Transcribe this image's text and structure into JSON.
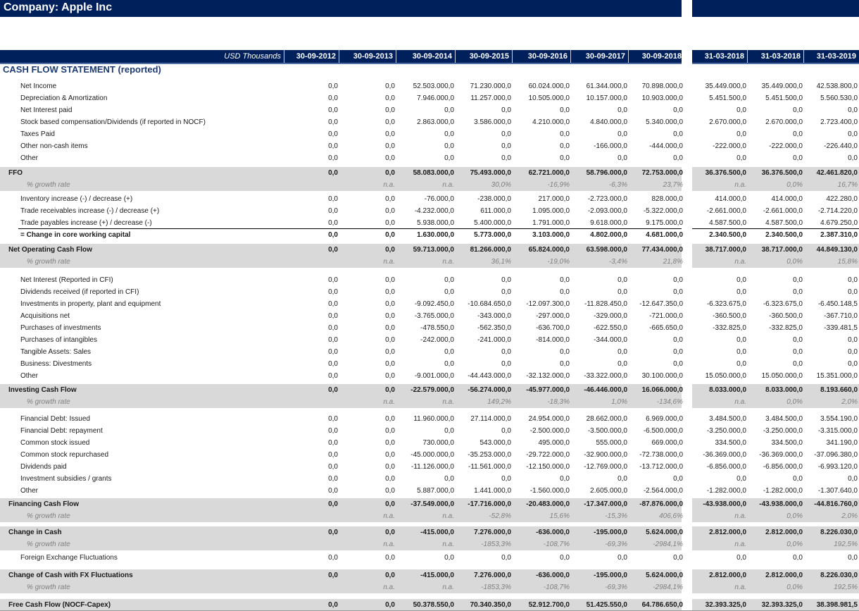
{
  "header": {
    "company_title": "Company: Apple Inc",
    "units": "USD Thousands",
    "columns": [
      "30-09-2012",
      "30-09-2013",
      "30-09-2014",
      "30-09-2015",
      "30-09-2016",
      "30-09-2017",
      "30-09-2018"
    ],
    "forecast_columns": [
      "31-03-2018",
      "31-03-2018",
      "31-03-2019"
    ]
  },
  "section_title": "CASH FLOW STATEMENT (reported)",
  "colors": {
    "header_navy": "#00205b",
    "band_gray": "#d9d9d9",
    "growth_gray": "#808080"
  },
  "rows": [
    {
      "label": "Net Income",
      "type": "item",
      "values": [
        "0,0",
        "0,0",
        "52.503.000,0",
        "71.230.000,0",
        "60.024.000,0",
        "61.344.000,0",
        "70.898.000,0"
      ],
      "forecast": [
        "35.449.000,0",
        "35.449.000,0",
        "42.538.800,0"
      ]
    },
    {
      "label": "Depreciation & Amortization",
      "type": "item",
      "values": [
        "0,0",
        "0,0",
        "7.946.000,0",
        "11.257.000,0",
        "10.505.000,0",
        "10.157.000,0",
        "10.903.000,0"
      ],
      "forecast": [
        "5.451.500,0",
        "5.451.500,0",
        "5.560.530,0"
      ]
    },
    {
      "label": "Net Interest paid",
      "type": "item",
      "values": [
        "0,0",
        "0,0",
        "0,0",
        "0,0",
        "0,0",
        "0,0",
        "0,0"
      ],
      "forecast": [
        "0,0",
        "0,0",
        "0,0"
      ]
    },
    {
      "label": "Stock based compensation/Dividends (if reported in NOCF)",
      "type": "item",
      "values": [
        "0,0",
        "0,0",
        "2.863.000,0",
        "3.586.000,0",
        "4.210.000,0",
        "4.840.000,0",
        "5.340.000,0"
      ],
      "forecast": [
        "2.670.000,0",
        "2.670.000,0",
        "2.723.400,0"
      ]
    },
    {
      "label": "Taxes Paid",
      "type": "item",
      "values": [
        "0,0",
        "0,0",
        "0,0",
        "0,0",
        "0,0",
        "0,0",
        "0,0"
      ],
      "forecast": [
        "0,0",
        "0,0",
        "0,0"
      ]
    },
    {
      "label": "Other non-cash items",
      "type": "item",
      "values": [
        "0,0",
        "0,0",
        "0,0",
        "0,0",
        "0,0",
        "-166.000,0",
        "-444.000,0"
      ],
      "forecast": [
        "-222.000,0",
        "-222.000,0",
        "-226.440,0"
      ]
    },
    {
      "label": "Other",
      "type": "item",
      "values": [
        "0,0",
        "0,0",
        "0,0",
        "0,0",
        "0,0",
        "0,0",
        "0,0"
      ],
      "forecast": [
        "0,0",
        "0,0",
        "0,0"
      ]
    },
    {
      "label": "FFO",
      "type": "total",
      "values": [
        "0,0",
        "0,0",
        "58.083.000,0",
        "75.493.000,0",
        "62.721.000,0",
        "58.796.000,0",
        "72.753.000,0"
      ],
      "forecast": [
        "36.376.500,0",
        "36.376.500,0",
        "42.461.820,0"
      ]
    },
    {
      "label": "% growth rate",
      "type": "growth",
      "values": [
        "",
        "n.a.",
        "n.a.",
        "30,0%",
        "-16,9%",
        "-6,3%",
        "23,7%"
      ],
      "forecast": [
        "n.a.",
        "0,0%",
        "16,7%"
      ]
    },
    {
      "label": "Inventory increase (-) / decrease (+)",
      "type": "item",
      "values": [
        "0,0",
        "0,0",
        "-76.000,0",
        "-238.000,0",
        "217.000,0",
        "-2.723.000,0",
        "828.000,0"
      ],
      "forecast": [
        "414.000,0",
        "414.000,0",
        "422.280,0"
      ]
    },
    {
      "label": "Trade receivables increase (-) / decrease (+)",
      "type": "item",
      "values": [
        "0,0",
        "0,0",
        "-4.232.000,0",
        "611.000,0",
        "1.095.000,0",
        "-2.093.000,0",
        "-5.322.000,0"
      ],
      "forecast": [
        "-2.661.000,0",
        "-2.661.000,0",
        "-2.714.220,0"
      ]
    },
    {
      "label": "Trade payables increase (+) / decrease (-)",
      "type": "item",
      "underline": true,
      "values": [
        "0,0",
        "0,0",
        "5.938.000,0",
        "5.400.000,0",
        "1.791.000,0",
        "9.618.000,0",
        "9.175.000,0"
      ],
      "forecast": [
        "4.587.500,0",
        "4.587.500,0",
        "4.679.250,0"
      ]
    },
    {
      "label": "= Change in core working capital",
      "type": "subtotal",
      "values": [
        "0,0",
        "0,0",
        "1.630.000,0",
        "5.773.000,0",
        "3.103.000,0",
        "4.802.000,0",
        "4.681.000,0"
      ],
      "forecast": [
        "2.340.500,0",
        "2.340.500,0",
        "2.387.310,0"
      ]
    },
    {
      "label": "Net Operating Cash Flow",
      "type": "total",
      "values": [
        "0,0",
        "0,0",
        "59.713.000,0",
        "81.266.000,0",
        "65.824.000,0",
        "63.598.000,0",
        "77.434.000,0"
      ],
      "forecast": [
        "38.717.000,0",
        "38.717.000,0",
        "44.849.130,0"
      ]
    },
    {
      "label": "% growth rate",
      "type": "growth",
      "values": [
        "",
        "n.a.",
        "n.a.",
        "36,1%",
        "-19,0%",
        "-3,4%",
        "21,8%"
      ],
      "forecast": [
        "n.a.",
        "0,0%",
        "15,8%"
      ]
    },
    {
      "label": "Net Interest (Reported in CFI)",
      "type": "item",
      "values": [
        "0,0",
        "0,0",
        "0,0",
        "0,0",
        "0,0",
        "0,0",
        "0,0"
      ],
      "forecast": [
        "0,0",
        "0,0",
        "0,0"
      ]
    },
    {
      "label": "Dividends received (if reported in CFI)",
      "type": "item",
      "values": [
        "0,0",
        "0,0",
        "0,0",
        "0,0",
        "0,0",
        "0,0",
        "0,0"
      ],
      "forecast": [
        "0,0",
        "0,0",
        "0,0"
      ]
    },
    {
      "label": "Investments in property, plant  and equipment",
      "type": "item",
      "values": [
        "0,0",
        "0,0",
        "-9.092.450,0",
        "-10.684.650,0",
        "-12.097.300,0",
        "-11.828.450,0",
        "-12.647.350,0"
      ],
      "forecast": [
        "-6.323.675,0",
        "-6.323.675,0",
        "-6.450.148,5"
      ]
    },
    {
      "label": "Acquisitions net",
      "type": "item",
      "values": [
        "0,0",
        "0,0",
        "-3.765.000,0",
        "-343.000,0",
        "-297.000,0",
        "-329.000,0",
        "-721.000,0"
      ],
      "forecast": [
        "-360.500,0",
        "-360.500,0",
        "-367.710,0"
      ]
    },
    {
      "label": "Purchases of investments",
      "type": "item",
      "values": [
        "0,0",
        "0,0",
        "-478.550,0",
        "-562.350,0",
        "-636.700,0",
        "-622.550,0",
        "-665.650,0"
      ],
      "forecast": [
        "-332.825,0",
        "-332.825,0",
        "-339.481,5"
      ]
    },
    {
      "label": "Purchases of intangibles",
      "type": "item",
      "values": [
        "0,0",
        "0,0",
        "-242.000,0",
        "-241.000,0",
        "-814.000,0",
        "-344.000,0",
        "0,0"
      ],
      "forecast": [
        "0,0",
        "0,0",
        "0,0"
      ]
    },
    {
      "label": "Tangible Assets: Sales",
      "type": "item",
      "values": [
        "0,0",
        "0,0",
        "0,0",
        "0,0",
        "0,0",
        "0,0",
        "0,0"
      ],
      "forecast": [
        "0,0",
        "0,0",
        "0,0"
      ]
    },
    {
      "label": "Business: Divestments",
      "type": "item",
      "values": [
        "0,0",
        "0,0",
        "0,0",
        "0,0",
        "0,0",
        "0,0",
        "0,0"
      ],
      "forecast": [
        "0,0",
        "0,0",
        "0,0"
      ]
    },
    {
      "label": "Other",
      "type": "item",
      "values": [
        "0,0",
        "0,0",
        "-9.001.000,0",
        "-44.443.000,0",
        "-32.132.000,0",
        "-33.322.000,0",
        "30.100.000,0"
      ],
      "forecast": [
        "15.050.000,0",
        "15.050.000,0",
        "15.351.000,0"
      ]
    },
    {
      "label": "Investing Cash Flow",
      "type": "total",
      "values": [
        "0,0",
        "0,0",
        "-22.579.000,0",
        "-56.274.000,0",
        "-45.977.000,0",
        "-46.446.000,0",
        "16.066.000,0"
      ],
      "forecast": [
        "8.033.000,0",
        "8.033.000,0",
        "8.193.660,0"
      ]
    },
    {
      "label": "% growth rate",
      "type": "growth",
      "values": [
        "",
        "n.a.",
        "n.a.",
        "149,2%",
        "-18,3%",
        "1,0%",
        "-134,6%"
      ],
      "forecast": [
        "n.a.",
        "0,0%",
        "2,0%"
      ]
    },
    {
      "label": "Financial Debt: Issued",
      "type": "item",
      "values": [
        "0,0",
        "0,0",
        "11.960.000,0",
        "27.114.000,0",
        "24.954.000,0",
        "28.662.000,0",
        "6.969.000,0"
      ],
      "forecast": [
        "3.484.500,0",
        "3.484.500,0",
        "3.554.190,0"
      ]
    },
    {
      "label": "Financial Debt: repayment",
      "type": "item",
      "values": [
        "0,0",
        "0,0",
        "0,0",
        "0,0",
        "-2.500.000,0",
        "-3.500.000,0",
        "-6.500.000,0"
      ],
      "forecast": [
        "-3.250.000,0",
        "-3.250.000,0",
        "-3.315.000,0"
      ]
    },
    {
      "label": "Common stock issued",
      "type": "item",
      "values": [
        "0,0",
        "0,0",
        "730.000,0",
        "543.000,0",
        "495.000,0",
        "555.000,0",
        "669.000,0"
      ],
      "forecast": [
        "334.500,0",
        "334.500,0",
        "341.190,0"
      ]
    },
    {
      "label": "Common stock repurchased",
      "type": "item",
      "values": [
        "0,0",
        "0,0",
        "-45.000.000,0",
        "-35.253.000,0",
        "-29.722.000,0",
        "-32.900.000,0",
        "-72.738.000,0"
      ],
      "forecast": [
        "-36.369.000,0",
        "-36.369.000,0",
        "-37.096.380,0"
      ]
    },
    {
      "label": "Dividends paid",
      "type": "item",
      "values": [
        "0,0",
        "0,0",
        "-11.126.000,0",
        "-11.561.000,0",
        "-12.150.000,0",
        "-12.769.000,0",
        "-13.712.000,0"
      ],
      "forecast": [
        "-6.856.000,0",
        "-6.856.000,0",
        "-6.993.120,0"
      ]
    },
    {
      "label": "Investment subsidies / grants",
      "type": "item",
      "values": [
        "0,0",
        "0,0",
        "0,0",
        "0,0",
        "0,0",
        "0,0",
        "0,0"
      ],
      "forecast": [
        "0,0",
        "0,0",
        "0,0"
      ]
    },
    {
      "label": "Other",
      "type": "item",
      "values": [
        "0,0",
        "0,0",
        "5.887.000,0",
        "1.441.000,0",
        "-1.560.000,0",
        "2.605.000,0",
        "-2.564.000,0"
      ],
      "forecast": [
        "-1.282.000,0",
        "-1.282.000,0",
        "-1.307.640,0"
      ]
    },
    {
      "label": "Financing Cash Flow",
      "type": "total",
      "values": [
        "0,0",
        "0,0",
        "-37.549.000,0",
        "-17.716.000,0",
        "-20.483.000,0",
        "-17.347.000,0",
        "-87.876.000,0"
      ],
      "forecast": [
        "-43.938.000,0",
        "-43.938.000,0",
        "-44.816.760,0"
      ]
    },
    {
      "label": "% growth rate",
      "type": "growth",
      "values": [
        "",
        "n.a.",
        "n.a.",
        "-52,8%",
        "15,6%",
        "-15,3%",
        "406,6%"
      ],
      "forecast": [
        "n.a.",
        "0,0%",
        "2,0%"
      ]
    },
    {
      "label": "Change in Cash",
      "type": "total",
      "values": [
        "0,0",
        "0,0",
        "-415.000,0",
        "7.276.000,0",
        "-636.000,0",
        "-195.000,0",
        "5.624.000,0"
      ],
      "forecast": [
        "2.812.000,0",
        "2.812.000,0",
        "8.226.030,0"
      ]
    },
    {
      "label": "% growth rate",
      "type": "growth",
      "values": [
        "",
        "n.a.",
        "n.a.",
        "-1853,3%",
        "-108,7%",
        "-69,3%",
        "-2984,1%"
      ],
      "forecast": [
        "n.a.",
        "0,0%",
        "192,5%"
      ]
    },
    {
      "label": "Foreign Exchange Fluctuations",
      "type": "item",
      "values": [
        "0,0",
        "0,0",
        "0,0",
        "0,0",
        "0,0",
        "0,0",
        "0,0"
      ],
      "forecast": [
        "0,0",
        "0,0",
        "0,0"
      ]
    },
    {
      "label": "Change of Cash with FX Fluctuations",
      "type": "total",
      "values": [
        "0,0",
        "0,0",
        "-415.000,0",
        "7.276.000,0",
        "-636.000,0",
        "-195.000,0",
        "5.624.000,0"
      ],
      "forecast": [
        "2.812.000,0",
        "2.812.000,0",
        "8.226.030,0"
      ]
    },
    {
      "label": "% growth rate",
      "type": "growth",
      "values": [
        "",
        "n.a.",
        "n.a.",
        "-1853,3%",
        "-108,7%",
        "-69,3%",
        "-2984,1%"
      ],
      "forecast": [
        "n.a.",
        "0,0%",
        "192,5%"
      ]
    },
    {
      "label": "Free Cash Flow (NOCF-Capex)",
      "type": "total",
      "bottom": true,
      "values": [
        "0,0",
        "0,0",
        "50.378.550,0",
        "70.340.350,0",
        "52.912.700,0",
        "51.425.550,0",
        "64.786.650,0"
      ],
      "forecast": [
        "32.393.325,0",
        "32.393.325,0",
        "38.398.981,5"
      ]
    }
  ]
}
